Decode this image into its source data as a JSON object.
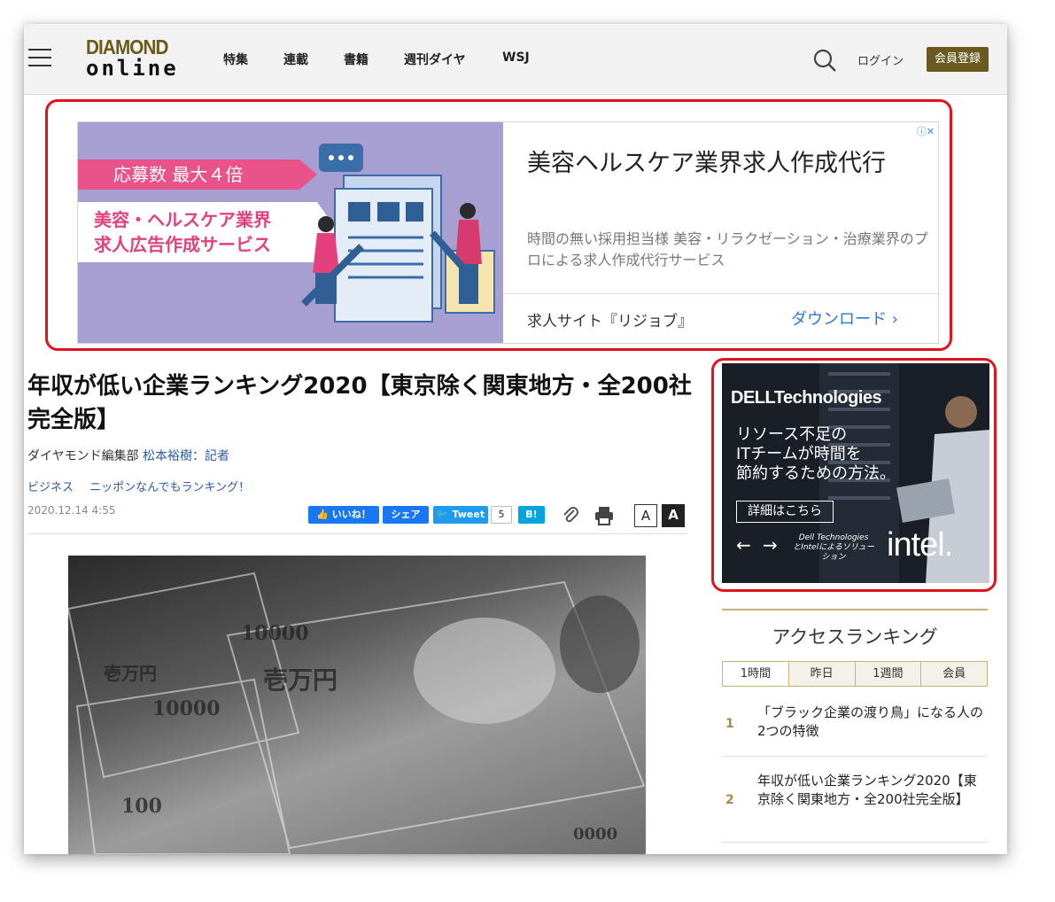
{
  "header": {
    "logo_line1": "DIAMOND",
    "logo_line2": "online",
    "nav": [
      "特集",
      "連載",
      "書籍",
      "週刊ダイヤ",
      "WSJ"
    ],
    "login": "ログイン",
    "register": "会員登録"
  },
  "ad_top": {
    "band1": "応募数 最大４倍",
    "band2_line1": "美容・ヘルスケア業界",
    "band2_line2": "求人広告作成サービス",
    "title": "美容ヘルスケア業界求人作成代行",
    "description": "時間の無い採用担当様 美容・リラクゼーション・治療業界のプロによる求人作成代行サービス",
    "site": "求人サイト『リジョブ』",
    "cta": "ダウンロード"
  },
  "article": {
    "title": "年収が低い企業ランキング2020【東京除く関東地方・全200社完全版】",
    "byline_dept": "ダイヤモンド編集部",
    "byline_author": "松本裕樹：記者",
    "tags": [
      "ビジネス",
      "ニッポンなんでもランキング！"
    ],
    "date": "2020.12.14 4:55",
    "share": {
      "like": "いいね！",
      "share": "シェア",
      "tweet": "Tweet",
      "count": "5",
      "hatena": "B!"
    },
    "font_small": "A",
    "font_large": "A"
  },
  "ad_side": {
    "brand": "DELLTechnologies",
    "text_line1": "リソース不足の",
    "text_line2": "ITチームが時間を",
    "text_line3": "節約するための方法。",
    "button": "詳細はこちら",
    "small_line1": "Dell Technologies",
    "small_line2": "とIntelによるソリューション",
    "intel": "intel."
  },
  "ranking": {
    "title": "アクセスランキング",
    "tabs": [
      "1時間",
      "昨日",
      "1週間",
      "会員"
    ],
    "items": [
      {
        "rank": "1",
        "text": "「ブラック企業の渡り鳥」になる人の2つの特徴"
      },
      {
        "rank": "2",
        "text": "年収が低い企業ランキング2020【東京除く関東地方・全200社完全版】"
      }
    ]
  },
  "colors": {
    "highlight": "#e1141d",
    "brand_gold": "#6b5a20",
    "link": "#2a5aa8"
  }
}
